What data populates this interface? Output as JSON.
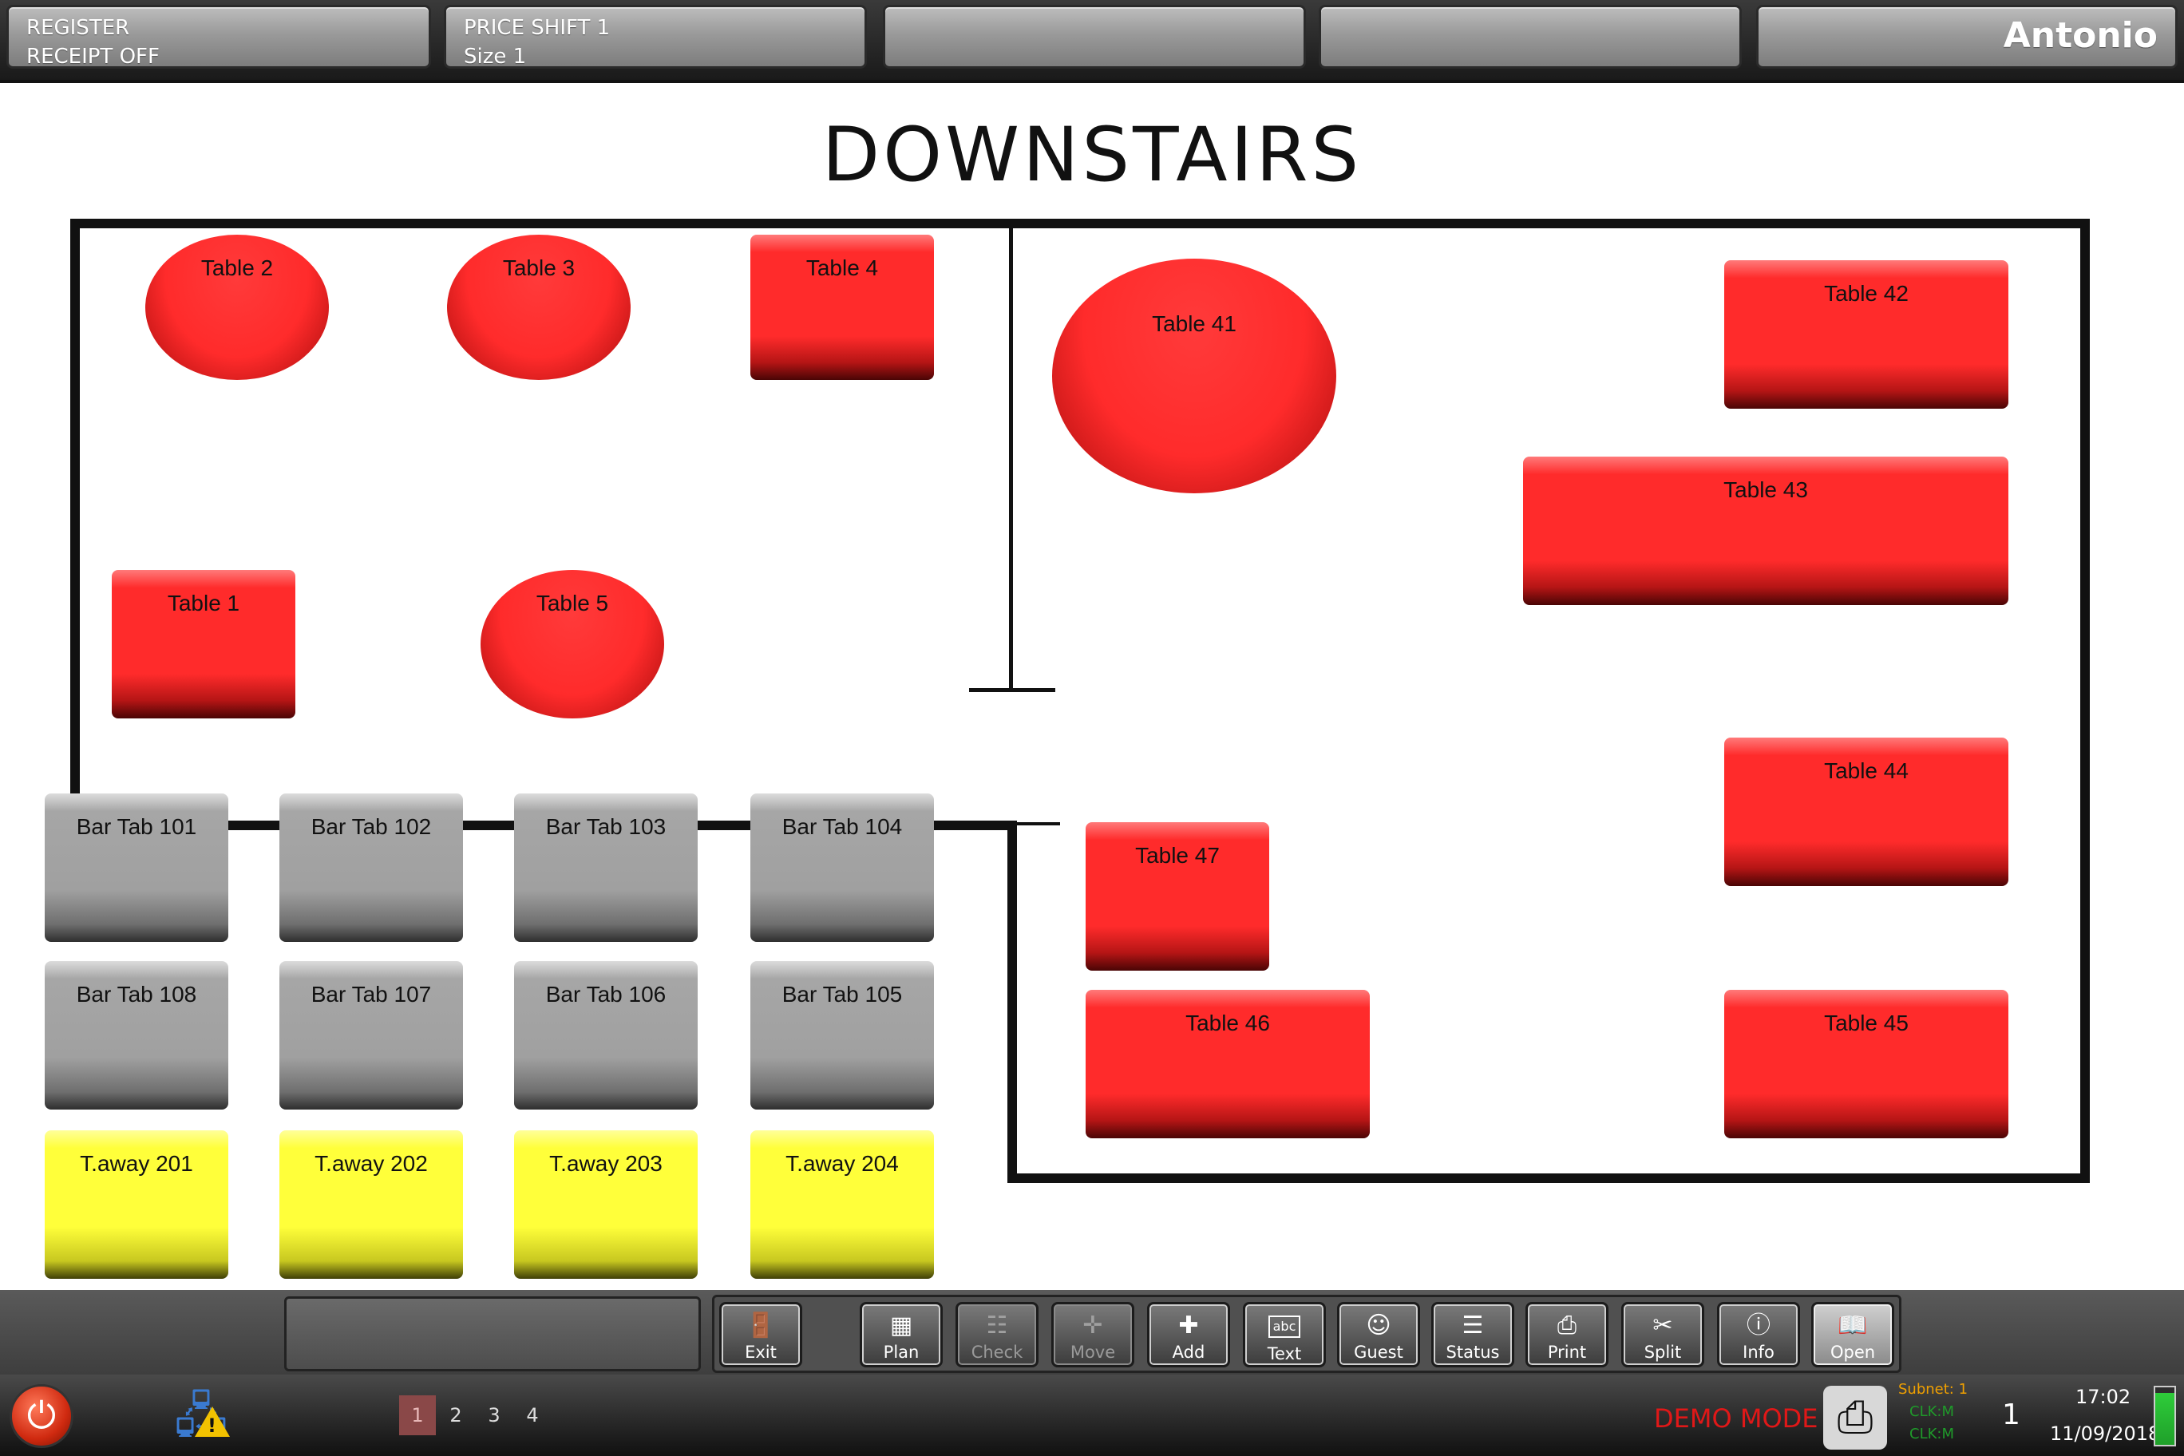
{
  "topbar": {
    "box1": {
      "line1": "REGISTER",
      "line2": "RECEIPT OFF"
    },
    "box2": {
      "line1": "PRICE SHIFT 1",
      "line2": "Size 1"
    },
    "user": "Antonio"
  },
  "floor": {
    "title": "DOWNSTAIRS",
    "tables": {
      "t1": "Table 1",
      "t2": "Table 2",
      "t3": "Table 3",
      "t4": "Table 4",
      "t5": "Table 5",
      "t41": "Table 41",
      "t42": "Table 42",
      "t43": "Table 43",
      "t44": "Table 44",
      "t45": "Table 45",
      "t46": "Table 46",
      "t47": "Table 47"
    },
    "bar_tabs": {
      "b101": "Bar Tab 101",
      "b102": "Bar Tab 102",
      "b103": "Bar Tab 103",
      "b104": "Bar Tab 104",
      "b105": "Bar Tab 105",
      "b106": "Bar Tab 106",
      "b107": "Bar Tab 107",
      "b108": "Bar Tab 108"
    },
    "takeaways": {
      "a201": "T.away 201",
      "a202": "T.away 202",
      "a203": "T.away 203",
      "a204": "T.away 204"
    },
    "colors": {
      "occupied": "#ff2b2b",
      "bar": "#a0a0a0",
      "takeaway": "#ffff3a"
    }
  },
  "toolbar": {
    "exit": "Exit",
    "plan": "Plan",
    "check": "Check",
    "move": "Move",
    "add": "Add",
    "text": "Text",
    "guest": "Guest",
    "status": "Status",
    "print": "Print",
    "split": "Split",
    "info": "Info",
    "open": "Open"
  },
  "sysbar": {
    "pages": [
      "1",
      "2",
      "3",
      "4"
    ],
    "current_page": "1",
    "demo_mode": "DEMO MODE",
    "subnet": "Subnet: 1",
    "clkm_1": "CLK:M",
    "clkm_2": "CLK:M",
    "station": "1",
    "time": "17:02",
    "date": "11/09/2018"
  }
}
